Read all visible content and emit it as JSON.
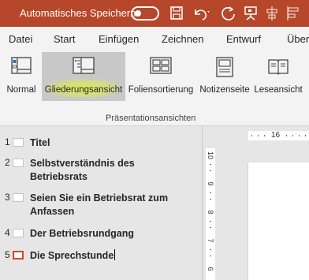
{
  "titlebar": {
    "autosave_label": "Automatisches Speichern",
    "autosave_state": "off",
    "icons": [
      "save-icon",
      "undo-icon",
      "redo-icon",
      "presentation-icon",
      "align-icon",
      "more-icon"
    ],
    "background": "#b7472a"
  },
  "tabs": [
    "Datei",
    "Start",
    "Einfügen",
    "Zeichnen",
    "Entwurf",
    "Überg"
  ],
  "ribbon": {
    "buttons": [
      {
        "label": "Normal",
        "icon": "normal-view-icon",
        "active": false
      },
      {
        "label": "Gliederungsansicht",
        "icon": "outline-view-icon",
        "active": true
      },
      {
        "label": "Foliensortierung",
        "icon": "slide-sorter-icon",
        "active": false
      },
      {
        "label": "Notizenseite",
        "icon": "notes-page-icon",
        "active": false
      },
      {
        "label": "Leseansicht",
        "icon": "reading-view-icon",
        "active": false
      }
    ],
    "group_label": "Präsentationsansichten",
    "highlight_color": "#dee85a"
  },
  "outline": {
    "slides": [
      {
        "number": "1",
        "title": "Titel",
        "selected": false
      },
      {
        "number": "2",
        "title": "Selbstverständnis des Betriebsrats",
        "selected": false
      },
      {
        "number": "3",
        "title": "Seien Sie ein Betriebsrat zum Anfassen",
        "selected": false
      },
      {
        "number": "4",
        "title": "Der Betriebsrundgang",
        "selected": false
      },
      {
        "number": "5",
        "title": "Die Sprechstunde",
        "selected": true
      }
    ],
    "selected_color": "#d24726"
  },
  "slide_pane": {
    "hruler_label": "16",
    "vruler_labels": [
      "10",
      "9",
      "8",
      "7",
      "6"
    ]
  }
}
